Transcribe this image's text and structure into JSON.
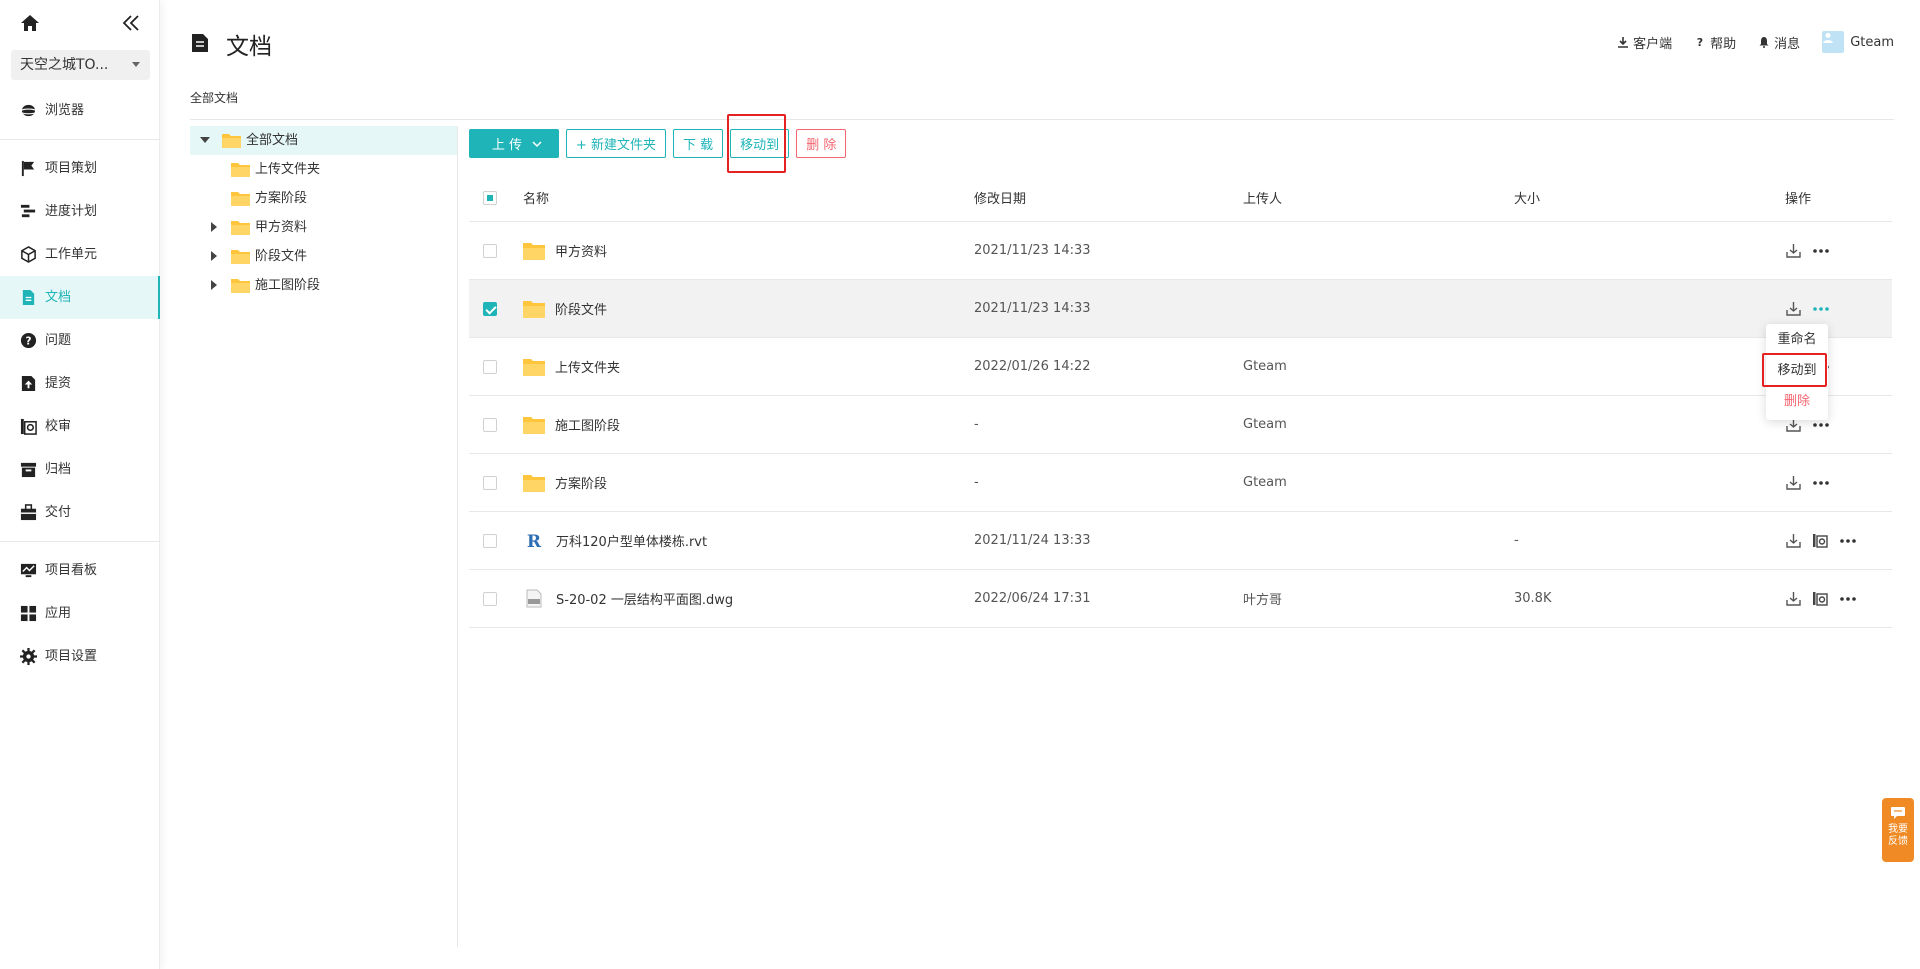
{
  "sidebar": {
    "project": "天空之城TO...",
    "items": [
      {
        "label": "浏览器",
        "icon": "browser-icon"
      },
      {
        "label": "项目策划",
        "icon": "flag-icon"
      },
      {
        "label": "进度计划",
        "icon": "gantt-icon"
      },
      {
        "label": "工作单元",
        "icon": "cube-icon"
      },
      {
        "label": "文档",
        "icon": "document-icon",
        "active": true
      },
      {
        "label": "问题",
        "icon": "question-icon"
      },
      {
        "label": "提资",
        "icon": "submit-icon"
      },
      {
        "label": "校审",
        "icon": "review-icon"
      },
      {
        "label": "归档",
        "icon": "archive-icon"
      },
      {
        "label": "交付",
        "icon": "briefcase-icon"
      },
      {
        "label": "项目看板",
        "icon": "dashboard-icon"
      },
      {
        "label": "应用",
        "icon": "apps-icon"
      },
      {
        "label": "项目设置",
        "icon": "gear-icon"
      }
    ]
  },
  "header": {
    "title": "文档",
    "client": "客户端",
    "help": "帮助",
    "messages": "消息",
    "user": "Gteam"
  },
  "breadcrumb": "全部文档",
  "tree": {
    "root": "全部文档",
    "children": [
      "上传文件夹",
      "方案阶段",
      "甲方资料",
      "阶段文件",
      "施工图阶段"
    ]
  },
  "toolbar": {
    "upload": "上 传",
    "new_folder": "+ 新建文件夹",
    "download": "下 载",
    "move_to": "移动到",
    "delete": "删 除"
  },
  "table": {
    "columns": {
      "name": "名称",
      "date": "修改日期",
      "uploader": "上传人",
      "size": "大小",
      "ops": "操作"
    },
    "rows": [
      {
        "name": "甲方资料",
        "date": "2021/11/23 14:33",
        "uploader": "",
        "size": "",
        "type": "folder"
      },
      {
        "name": "阶段文件",
        "date": "2021/11/23 14:33",
        "uploader": "",
        "size": "",
        "type": "folder",
        "selected": true
      },
      {
        "name": "上传文件夹",
        "date": "2022/01/26 14:22",
        "uploader": "Gteam",
        "size": "",
        "type": "folder"
      },
      {
        "name": "施工图阶段",
        "date": "-",
        "uploader": "Gteam",
        "size": "",
        "type": "folder"
      },
      {
        "name": "方案阶段",
        "date": "-",
        "uploader": "Gteam",
        "size": "",
        "type": "folder"
      },
      {
        "name": "万科120户型单体楼栋.rvt",
        "date": "2021/11/24 13:33",
        "uploader": "",
        "size": "-",
        "type": "rvt"
      },
      {
        "name": "S-20-02 一层结构平面图.dwg",
        "date": "2022/06/24 17:31",
        "uploader": "叶方哥",
        "size": "30.8K",
        "type": "dwg"
      }
    ]
  },
  "dropdown": {
    "rename": "重命名",
    "move_to": "移动到",
    "delete": "删除"
  },
  "feedback": {
    "line1": "我要",
    "line2": "反馈"
  },
  "colors": {
    "accent": "#1fb5b8",
    "danger": "#f5646f",
    "folder": "#ffc53d",
    "highlight": "#e52222",
    "feedback": "#f08a24"
  }
}
